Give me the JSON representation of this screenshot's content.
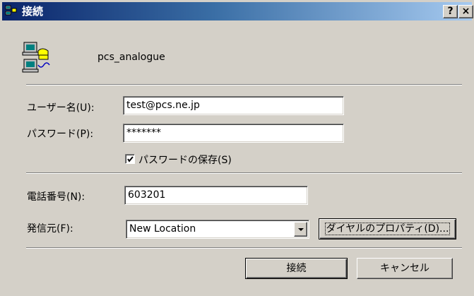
{
  "window": {
    "title": "接続",
    "help_button": "?",
    "close_button": "×"
  },
  "connection": {
    "name": "pcs_analogue",
    "icon": "dialup-connection-icon"
  },
  "fields": {
    "username_label": "ユーザー名(U):",
    "username_value": "test@pcs.ne.jp",
    "password_label": "パスワード(P):",
    "password_value": "*******",
    "save_password_label": "パスワードの保存(S)",
    "save_password_checked": true,
    "phone_label": "電話番号(N):",
    "phone_value": "603201",
    "dial_from_label": "発信元(F):",
    "dial_from_value": "New Location"
  },
  "buttons": {
    "dial_properties": "ダイヤルのプロパティ(D)...",
    "connect": "接続",
    "cancel": "キャンセル"
  },
  "colors": {
    "titlebar_start": "#0a246a",
    "titlebar_end": "#a6caf0",
    "face": "#d4d0c8"
  }
}
